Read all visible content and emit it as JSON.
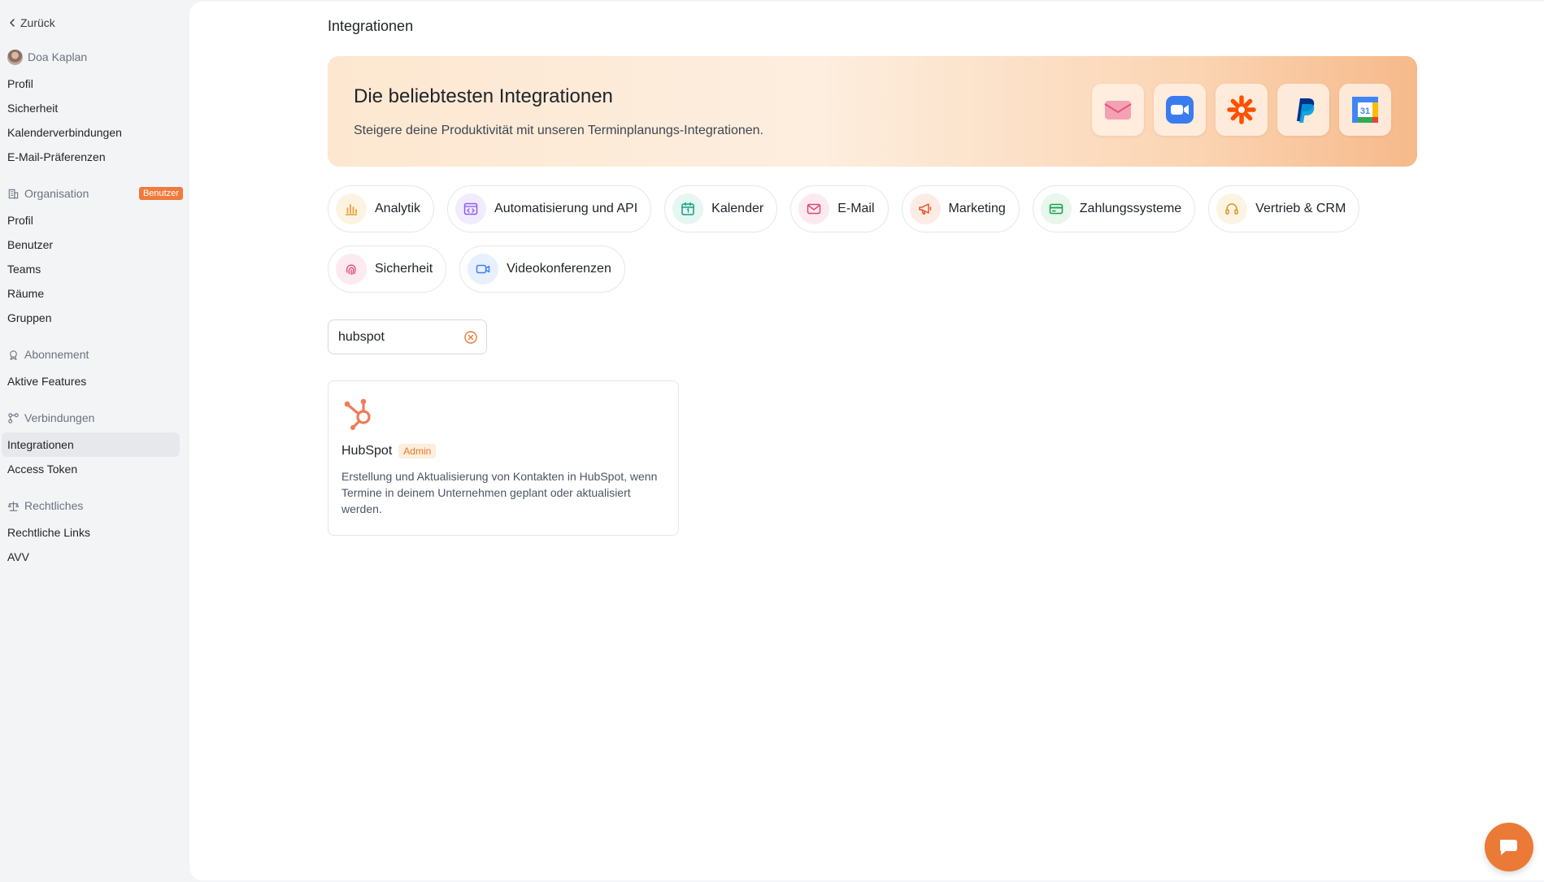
{
  "sidebar": {
    "back_label": "Zurück",
    "user": {
      "name": "Doa Kaplan",
      "items": [
        "Profil",
        "Sicherheit",
        "Kalenderverbindungen",
        "E-Mail-Präferenzen"
      ]
    },
    "organisation": {
      "label": "Organisation",
      "badge": "Benutzer",
      "items": [
        "Profil",
        "Benutzer",
        "Teams",
        "Räume",
        "Gruppen"
      ]
    },
    "abonnement": {
      "label": "Abonnement",
      "items": [
        "Aktive Features"
      ]
    },
    "verbindungen": {
      "label": "Verbindungen",
      "items": [
        "Integrationen",
        "Access Token"
      ],
      "active": "Integrationen"
    },
    "rechtliches": {
      "label": "Rechtliches",
      "items": [
        "Rechtliche Links",
        "AVV"
      ]
    }
  },
  "main": {
    "title": "Integrationen",
    "hero": {
      "title": "Die beliebtesten Integrationen",
      "subtitle": "Steigere deine Produktivität mit unseren Terminplanungs-Integrationen.",
      "icons": [
        "mail-app-icon",
        "zoom-icon",
        "zapier-icon",
        "paypal-icon",
        "google-calendar-icon"
      ],
      "calendar_day": "31"
    },
    "categories": [
      {
        "label": "Analytik",
        "icon": "bar-chart-icon",
        "color": "#e8a13a",
        "bg": "#fdf3e3"
      },
      {
        "label": "Automatisierung und API",
        "icon": "code-window-icon",
        "color": "#8b5cf6",
        "bg": "#f1ecfd"
      },
      {
        "label": "Kalender",
        "icon": "calendar-icon",
        "color": "#10a37f",
        "bg": "#e6f6f1"
      },
      {
        "label": "E-Mail",
        "icon": "mail-icon",
        "color": "#e0457b",
        "bg": "#fdeaf1"
      },
      {
        "label": "Marketing",
        "icon": "megaphone-icon",
        "color": "#e5532d",
        "bg": "#fdece6"
      },
      {
        "label": "Zahlungssysteme",
        "icon": "credit-card-icon",
        "color": "#16a34a",
        "bg": "#e8f6ec"
      },
      {
        "label": "Vertrieb & CRM",
        "icon": "headset-icon",
        "color": "#d99a1e",
        "bg": "#fcf4e2"
      },
      {
        "label": "Sicherheit",
        "icon": "fingerprint-icon",
        "color": "#e0457b",
        "bg": "#fdeaf1"
      },
      {
        "label": "Videokonferenzen",
        "icon": "video-icon",
        "color": "#3b82f6",
        "bg": "#e8f0fe"
      }
    ],
    "search": {
      "value": "hubspot",
      "placeholder": ""
    },
    "results": [
      {
        "title": "HubSpot",
        "badge": "Admin",
        "description": "Erstellung und Aktualisierung von Kontakten in HubSpot, wenn Termine in deinem Unternehmen geplant oder aktualisiert werden.",
        "icon": "hubspot-icon",
        "brand_color": "#f07a5a"
      }
    ]
  },
  "colors": {
    "accent": "#ea7a35",
    "badge_orange": "#f07a3c"
  }
}
